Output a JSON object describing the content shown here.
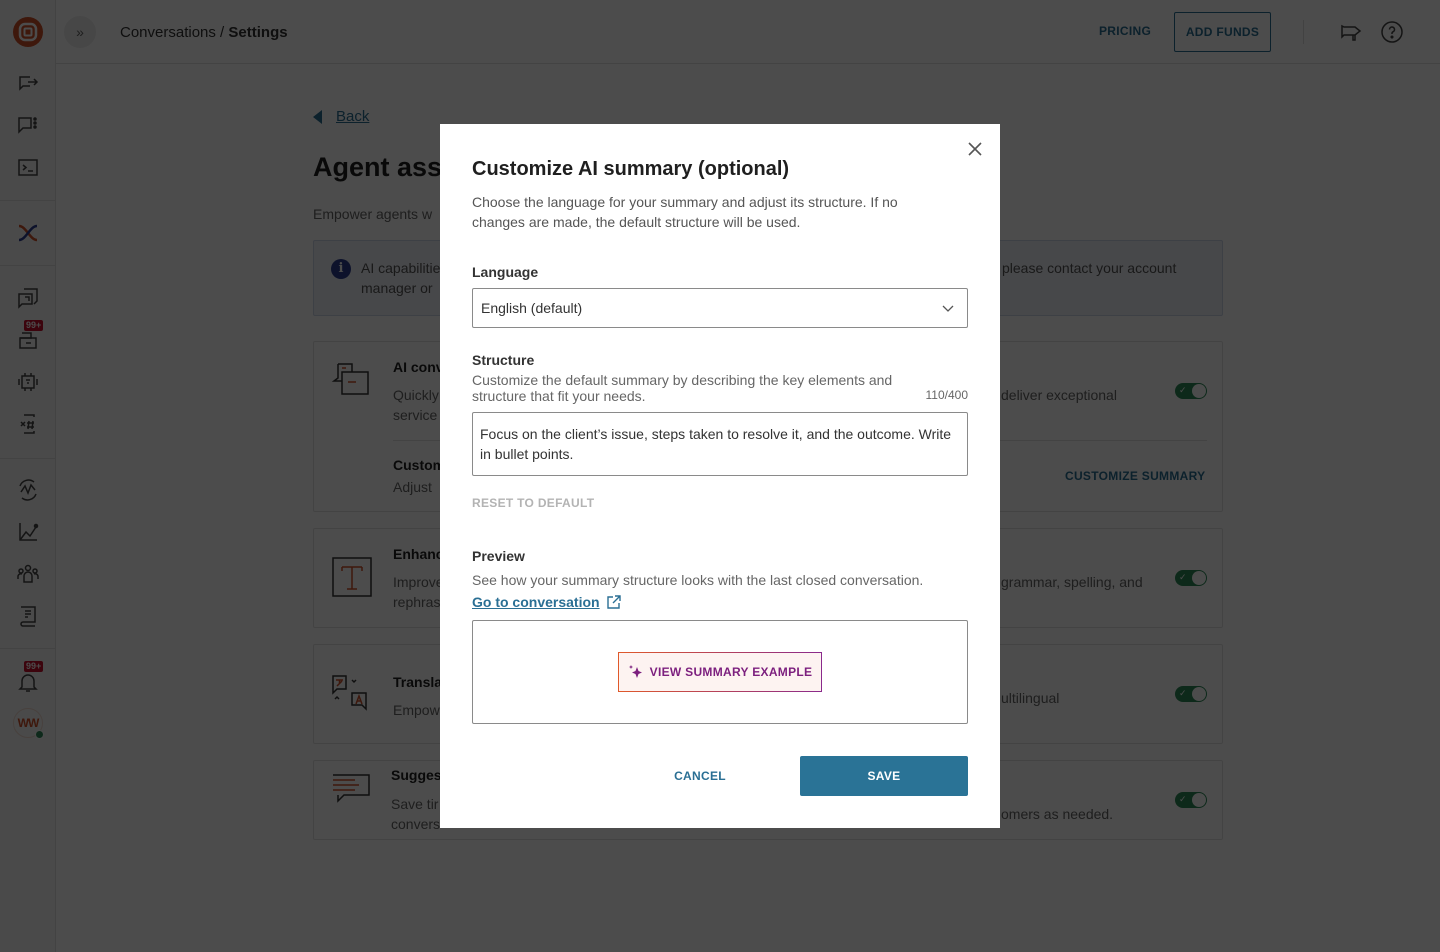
{
  "topbar": {
    "breadcrumb_parent": "Conversations",
    "breadcrumb_separator": " / ",
    "breadcrumb_current": "Settings",
    "pricing_label": "PRICING",
    "add_funds_label": "ADD FUNDS"
  },
  "sidebar": {
    "items": [
      {
        "icon": "export-icon"
      },
      {
        "icon": "chat-more-icon"
      },
      {
        "icon": "terminal-icon"
      },
      {
        "icon": "brand-x-icon"
      },
      {
        "icon": "copy-chat-icon"
      },
      {
        "icon": "inbox-icon",
        "badge": "99+"
      },
      {
        "icon": "bot-icon"
      },
      {
        "icon": "hashtag-icon"
      },
      {
        "icon": "activity-icon"
      },
      {
        "icon": "analytics-icon"
      },
      {
        "icon": "people-icon"
      },
      {
        "icon": "book-icon"
      },
      {
        "icon": "bell-icon",
        "badge": "99+"
      }
    ],
    "avatar_initials": "WW"
  },
  "page": {
    "back_label": "Back",
    "title_fragment": "Agent assi",
    "subtitle_fragment": "Empower agents w",
    "info": {
      "line1_fragment": "AI capabilitie",
      "line2_fragment": "manager or",
      "line1_right_fragment": "please contact your account"
    },
    "cards": [
      {
        "title_fragment": "AI conv",
        "desc1_fragment": "Quickly",
        "desc2_fragment": "service",
        "desc_right_fragment": "deliver exceptional",
        "toggle_on": true,
        "sub_title_fragment": "Custom",
        "sub_desc_fragment": "Adjust",
        "action_label": "CUSTOMIZE SUMMARY"
      },
      {
        "title_fragment": "Enhanc",
        "desc1_fragment": "Improve",
        "desc2_fragment": "rephras",
        "desc_right_fragment": "grammar, spelling, and",
        "toggle_on": true
      },
      {
        "title_fragment": "Transla",
        "desc1_fragment": "Empow",
        "desc_right_fragment": "ultilingual",
        "toggle_on": true
      },
      {
        "title_fragment": "Sugges",
        "desc1_fragment": "Save tir",
        "desc2_fragment": "convers",
        "desc_right_fragment": "omers as needed.",
        "toggle_on": true
      }
    ]
  },
  "modal": {
    "title": "Customize AI summary (optional)",
    "description": "Choose the language for your summary and adjust its structure. If no changes are made, the default structure will be used.",
    "language": {
      "label": "Language",
      "selected": "English (default)"
    },
    "structure": {
      "label": "Structure",
      "description": "Customize the default summary by describing the key elements and structure that fit your needs.",
      "counter": "110/400",
      "value": "Focus on the client’s issue, steps taken to resolve it, and the outcome. Write in bullet points.",
      "reset_label": "RESET TO DEFAULT"
    },
    "preview": {
      "label": "Preview",
      "description": "See how your summary structure looks with the last closed conversation.",
      "link_label": "Go to conversation",
      "view_example_label": "VIEW SUMMARY EXAMPLE"
    },
    "cancel_label": "CANCEL",
    "save_label": "SAVE"
  },
  "colors": {
    "primary": "#2a7396",
    "toggle_on": "#2c8a57",
    "badge": "#c8102e",
    "brand": "#d0502a",
    "ai_accent": "#7c1f7e"
  }
}
